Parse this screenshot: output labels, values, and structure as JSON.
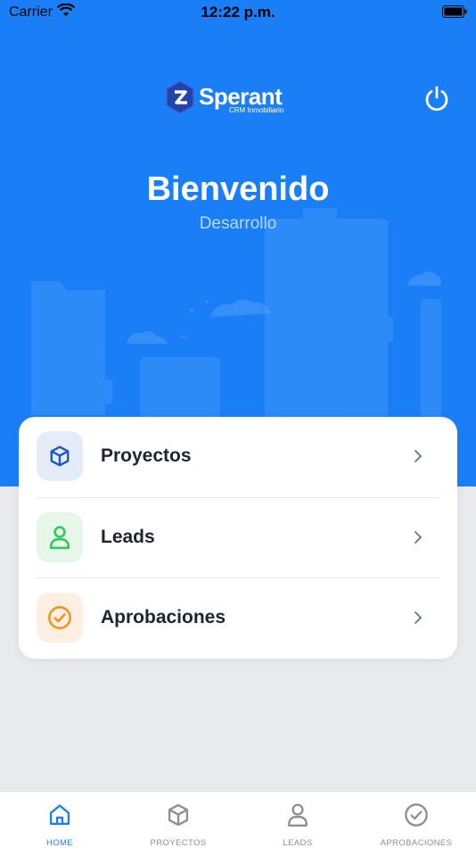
{
  "status_bar": {
    "carrier": "Carrier",
    "time": "12:22 p.m."
  },
  "header": {
    "logo_text": "Sperant",
    "logo_subtitle": "CRM Inmobiliario",
    "welcome_title": "Bienvenido",
    "welcome_subtitle": "Desarrollo"
  },
  "menu": {
    "items": [
      {
        "label": "Proyectos",
        "icon": "cube-icon",
        "icon_color": "#1e56c8",
        "bg_color": "#e4ecf9"
      },
      {
        "label": "Leads",
        "icon": "user-icon",
        "icon_color": "#34c759",
        "bg_color": "#e6f7e9"
      },
      {
        "label": "Aprobaciones",
        "icon": "check-circle-icon",
        "icon_color": "#f5931e",
        "bg_color": "#fdf0e2"
      }
    ]
  },
  "tabbar": {
    "tabs": [
      {
        "label": "HOME",
        "icon": "home-icon",
        "active": true
      },
      {
        "label": "PROYECTOS",
        "icon": "cube-icon",
        "active": false
      },
      {
        "label": "LEADS",
        "icon": "user-icon",
        "active": false
      },
      {
        "label": "APROBACIONES",
        "icon": "check-circle-icon",
        "active": false
      }
    ]
  },
  "colors": {
    "primary": "#1a7ff7",
    "background": "#e8eaee",
    "text_dark": "#1d2433",
    "tab_inactive": "#8e8e93"
  }
}
